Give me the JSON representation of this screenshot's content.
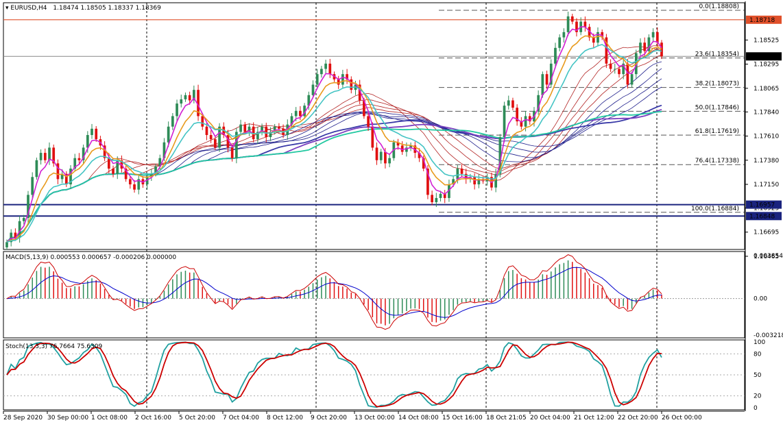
{
  "header": {
    "symbol": "EURUSD,H4",
    "ohlc": "1.18474 1.18505 1.18337 1.18369"
  },
  "colors": {
    "bull": "#2e8b57",
    "bear": "#e01010",
    "ema_fast": "#d21fd2",
    "ema_mid": "#e89a1c",
    "ema_slow": "#44c4c4",
    "ribbon_red": "#b22222",
    "ribbon_blue": "#1c1c8a",
    "ma_green": "#20c8a0",
    "level": "#1a237e",
    "resist": "#e0502a",
    "macd_signal": "#0000cc",
    "macd_main": "#cc0000",
    "stoch_main": "#20a0a0",
    "stoch_signal": "#cc0000"
  },
  "chart_data": [
    {
      "type": "candlestick",
      "name": "main",
      "ylim": [
        1.1653,
        1.1888
      ],
      "price_labels": [
        "1.18525",
        "1.18295",
        "1.18065",
        "1.17840",
        "1.17610",
        "1.17380",
        "1.17150",
        "1.16925",
        "1.16695",
        "1.16465"
      ],
      "price_label_values": [
        1.18525,
        1.18295,
        1.18065,
        1.1784,
        1.1761,
        1.1738,
        1.1715,
        1.16925,
        1.16695,
        1.16465
      ],
      "current_price": {
        "label": "1.18369",
        "value": 1.18369
      },
      "resistance": {
        "label": "1.18718",
        "value": 1.18718
      },
      "support_levels": [
        {
          "label": "1.16957",
          "value": 1.16957
        },
        {
          "label": "1.16848",
          "value": 1.16848
        }
      ],
      "fib_levels": [
        {
          "label": "0.0(1.18808)",
          "value": 1.18808
        },
        {
          "label": "23.6(1.18354)",
          "value": 1.18354
        },
        {
          "label": "38.2(1.18073)",
          "value": 1.18073
        },
        {
          "label": "50.0(1.17846)",
          "value": 1.17846
        },
        {
          "label": "61.8(1.17619)",
          "value": 1.17619
        },
        {
          "label": "76.4(1.17338)",
          "value": 1.17338
        },
        {
          "label": "100.0(1.16884)",
          "value": 1.16884
        }
      ],
      "time_labels": [
        "28 Sep 2020",
        "30 Sep 00:00",
        "1 Oct 08:00",
        "2 Oct 16:00",
        "5 Oct 20:00",
        "7 Oct 04:00",
        "8 Oct 12:00",
        "9 Oct 20:00",
        "13 Oct 00:00",
        "14 Oct 08:00",
        "15 Oct 16:00",
        "18 Oct 21:05",
        "20 Oct 04:00",
        "21 Oct 12:00",
        "22 Oct 20:00",
        "26 Oct 00:00"
      ],
      "closes": [
        1.166,
        1.1669,
        1.1664,
        1.168,
        1.1683,
        1.1705,
        1.1722,
        1.1738,
        1.1745,
        1.1738,
        1.175,
        1.1735,
        1.172,
        1.1725,
        1.1715,
        1.173,
        1.174,
        1.1738,
        1.175,
        1.1762,
        1.1768,
        1.1758,
        1.1752,
        1.174,
        1.173,
        1.1725,
        1.1738,
        1.173,
        1.172,
        1.1715,
        1.171,
        1.172,
        1.1715,
        1.1722,
        1.1725,
        1.1732,
        1.174,
        1.1755,
        1.177,
        1.178,
        1.1792,
        1.1796,
        1.18,
        1.1795,
        1.1805,
        1.178,
        1.177,
        1.1762,
        1.1758,
        1.175,
        1.177,
        1.1762,
        1.175,
        1.174,
        1.1765,
        1.1772,
        1.1765,
        1.177,
        1.1758,
        1.1765,
        1.177,
        1.176,
        1.1765,
        1.177,
        1.1768,
        1.1762,
        1.1772,
        1.178,
        1.1785,
        1.178,
        1.179,
        1.18,
        1.181,
        1.182,
        1.1825,
        1.183,
        1.182,
        1.1815,
        1.181,
        1.182,
        1.1815,
        1.1805,
        1.181,
        1.1795,
        1.178,
        1.177,
        1.175,
        1.1738,
        1.1746,
        1.1735,
        1.174,
        1.1755,
        1.1752,
        1.1746,
        1.175,
        1.1752,
        1.1745,
        1.174,
        1.173,
        1.1705,
        1.1698,
        1.1702,
        1.1706,
        1.1702,
        1.1715,
        1.172,
        1.173,
        1.1725,
        1.172,
        1.1722,
        1.1715,
        1.172,
        1.1718,
        1.1722,
        1.1712,
        1.1725,
        1.176,
        1.179,
        1.1795,
        1.1788,
        1.1775,
        1.177,
        1.178,
        1.1775,
        1.1785,
        1.18,
        1.182,
        1.181,
        1.183,
        1.1845,
        1.1855,
        1.186,
        1.1875,
        1.187,
        1.186,
        1.187,
        1.1865,
        1.1855,
        1.185,
        1.186,
        1.1855,
        1.183,
        1.1825,
        1.1825,
        1.182,
        1.183,
        1.181,
        1.182,
        1.184,
        1.185,
        1.1842,
        1.1855,
        1.186,
        1.185,
        1.18369
      ]
    },
    {
      "type": "line",
      "name": "macd",
      "label": "MACD(5,13,9) 0.000553 0.000657 -0.000206 0.000000",
      "ylim": [
        -0.003218,
        0.003854
      ],
      "axis_labels": [
        "0.003854",
        "0.00",
        "-0.003218"
      ],
      "axis_values": [
        0.003854,
        0.0,
        -0.003218
      ]
    },
    {
      "type": "line",
      "name": "stochastic",
      "label": "Stoch(13,3,3) 76.7664 75.6309",
      "ylim": [
        0,
        100
      ],
      "axis_labels": [
        "100",
        "80",
        "50",
        "20",
        "0"
      ],
      "axis_values": [
        100,
        80,
        50,
        20,
        0
      ]
    }
  ]
}
